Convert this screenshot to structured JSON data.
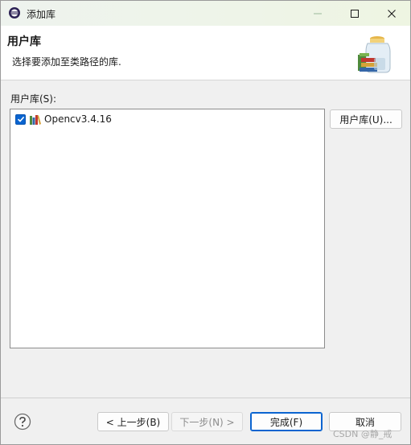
{
  "window": {
    "title": "添加库",
    "controls": {
      "minimize": "minimize-icon",
      "maximize": "maximize-icon",
      "close": "close-icon"
    }
  },
  "header": {
    "title": "用户库",
    "description": "选择要添加至类路径的库."
  },
  "library_section": {
    "label": "用户库(S):",
    "items": [
      {
        "name": "Opencv3.4.16",
        "checked": true,
        "icon": "library-books-icon"
      }
    ],
    "user_libraries_button": "用户库(U)..."
  },
  "footer": {
    "help_icon": "help-icon",
    "back_button": "< 上一步(B)",
    "next_button": "下一步(N) >",
    "finish_button": "完成(F)",
    "cancel_button": "取消"
  },
  "watermark": "CSDN @静_戒",
  "colors": {
    "accent": "#0a64d0",
    "titlebar": "#eef4e8",
    "dialog_bg": "#f0f0f0"
  }
}
